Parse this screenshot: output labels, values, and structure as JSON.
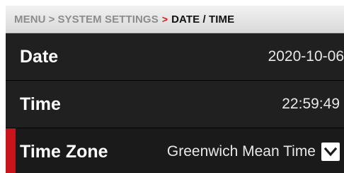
{
  "breadcrumb": {
    "items": [
      "MENU",
      "SYSTEM SETTINGS"
    ],
    "current": "DATE / TIME",
    "separator": ">",
    "accent_color": "#d11a1a"
  },
  "settings": {
    "date": {
      "label": "Date",
      "value": "2020-10-06"
    },
    "time": {
      "label": "Time",
      "value": "22:59:49"
    },
    "timezone": {
      "label": "Time Zone",
      "value": "Greenwich Mean Time",
      "icon": "chevron-down-icon",
      "selected": true
    }
  },
  "colors": {
    "background": "#1c1c1c",
    "selection_accent": "#c8141b"
  }
}
